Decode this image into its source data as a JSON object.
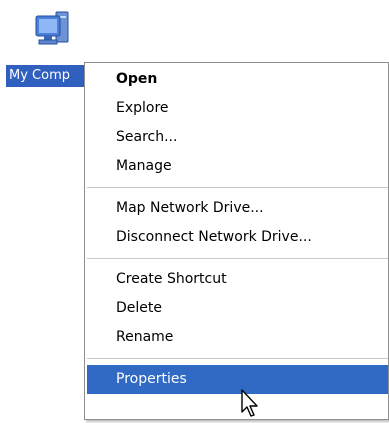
{
  "desktop": {
    "icon_label": "My Comp",
    "icon_name": "my-computer-icon"
  },
  "context_menu": {
    "groups": [
      [
        "Open",
        "Explore",
        "Search...",
        "Manage"
      ],
      [
        "Map Network Drive...",
        "Disconnect Network Drive..."
      ],
      [
        "Create Shortcut",
        "Delete",
        "Rename"
      ],
      [
        "Properties"
      ]
    ],
    "default_item": "Open",
    "highlighted_item": "Properties",
    "highlight_color": "#316ac5"
  },
  "cursor": {
    "icon_name": "arrow-cursor-icon"
  }
}
